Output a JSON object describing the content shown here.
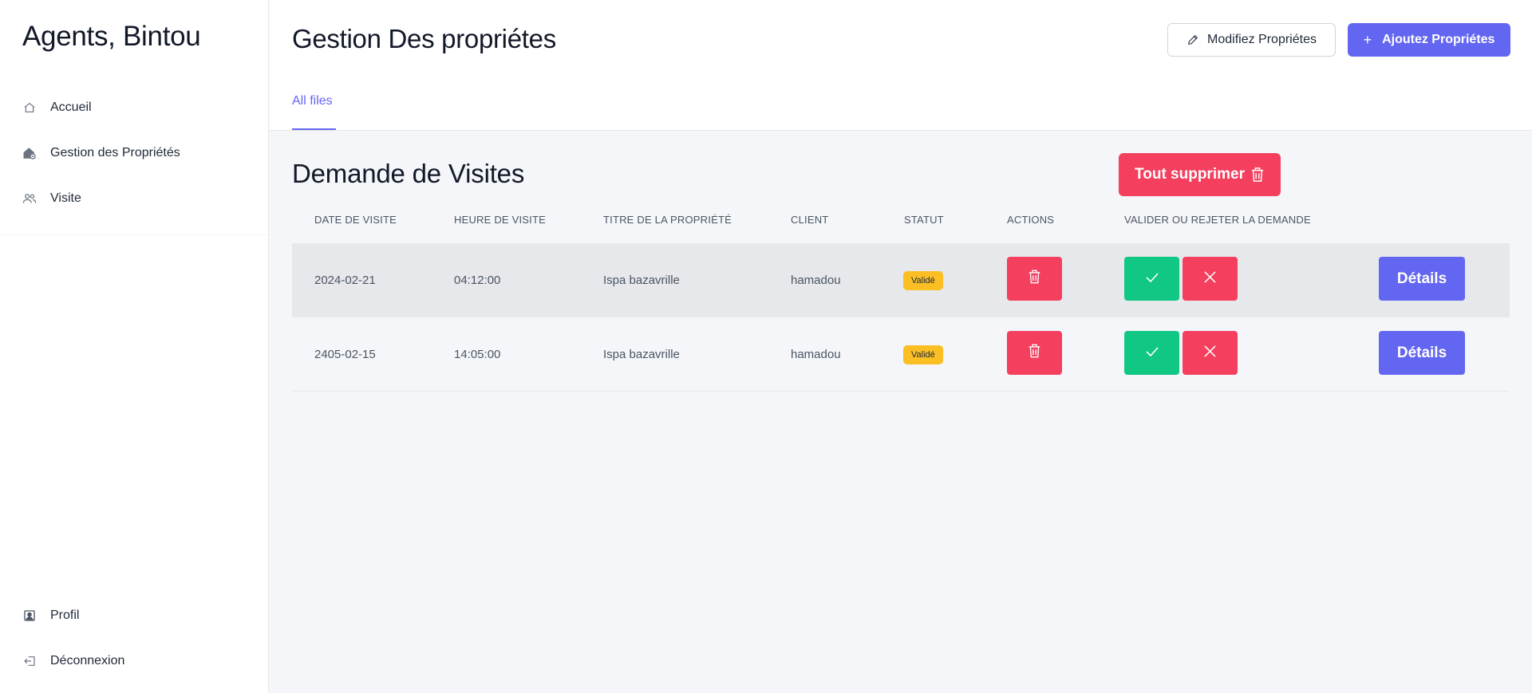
{
  "sidebar": {
    "brand": "Agents, Bintou",
    "items": [
      {
        "label": "Accueil",
        "icon": "home-icon"
      },
      {
        "label": "Gestion des Propriétés",
        "icon": "house-gear-icon"
      },
      {
        "label": "Visite",
        "icon": "users-icon"
      }
    ],
    "bottom_items": [
      {
        "label": "Profil",
        "icon": "profile-icon"
      },
      {
        "label": "Déconnexion",
        "icon": "logout-icon"
      }
    ]
  },
  "header": {
    "title": "Gestion Des propriétes",
    "modify_label": "Modifiez Propriétes",
    "add_icon": "+",
    "add_label": "Ajoutez Propriétes",
    "tab_label": "All files"
  },
  "main": {
    "section_title": "Demande de Visites",
    "delete_all_label": "Tout supprimer",
    "columns": [
      "DATE DE VISITE",
      "HEURE DE VISITE",
      "TITRE DE LA PROPRIÉTÉ",
      "CLIENT",
      "STATUT",
      "ACTIONS",
      "VALIDER OU REJETER LA DEMANDE"
    ],
    "rows": [
      {
        "date": "2024-02-21",
        "heure": "04:12:00",
        "titre": "Ispa bazavrille",
        "client": "hamadou",
        "statut": "Validé",
        "details": "Détails"
      },
      {
        "date": "2405-02-15",
        "heure": "14:05:00",
        "titre": "Ispa bazavrille",
        "client": "hamadou",
        "statut": "Validé",
        "details": "Détails"
      }
    ]
  },
  "colors": {
    "primary": "#6366f1",
    "danger": "#f43f5e",
    "success": "#10c784",
    "badge": "#fbbf24"
  }
}
